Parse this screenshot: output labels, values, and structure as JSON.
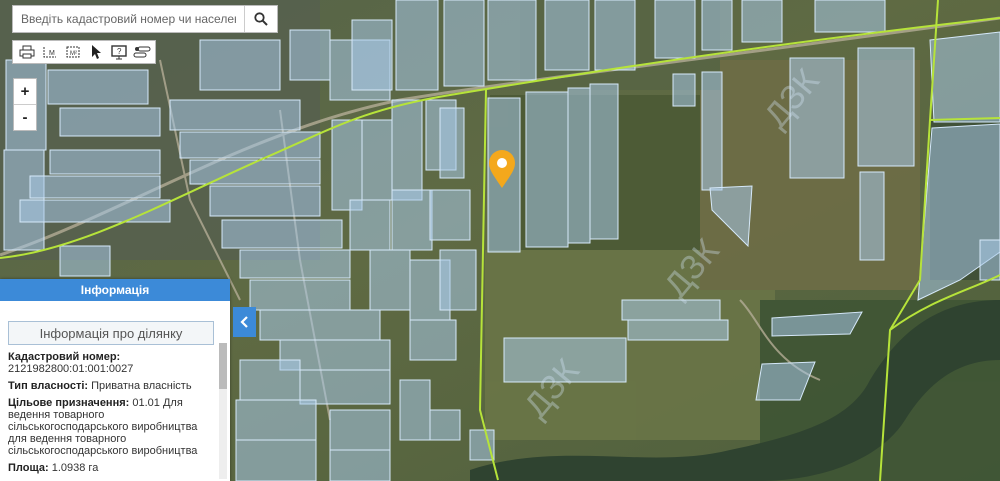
{
  "search": {
    "placeholder": "Введіть кадастровий номер чи населення"
  },
  "toolbar": {
    "tools": [
      "print-icon",
      "measure-length-icon",
      "measure-area-icon",
      "pointer-icon",
      "monitor-info-icon",
      "layers-icon"
    ]
  },
  "zoom": {
    "in_label": "+",
    "out_label": "-"
  },
  "info_panel": {
    "header": "Інформація",
    "subtitle": "Інформація про ділянку",
    "fields": [
      {
        "label": "Кадастровий номер:",
        "value": "2121982800:01:001:0027"
      },
      {
        "label": "Тип власності:",
        "value": "Приватна власність"
      },
      {
        "label": "Цільове призначення:",
        "value": "01.01 Для ведення товарного сільськогосподарського виробництва для ведення товарного сільськогосподарського виробництва"
      },
      {
        "label": "Площа:",
        "value": "1.0938 га"
      }
    ]
  },
  "colors": {
    "parcel_fill": "#a8c8e8",
    "parcel_stroke": "#cfe4f7",
    "boundary": "#b6e33a",
    "marker": "#f4a81c",
    "accent": "#3c8ad8"
  },
  "watermark": "ДЗК"
}
